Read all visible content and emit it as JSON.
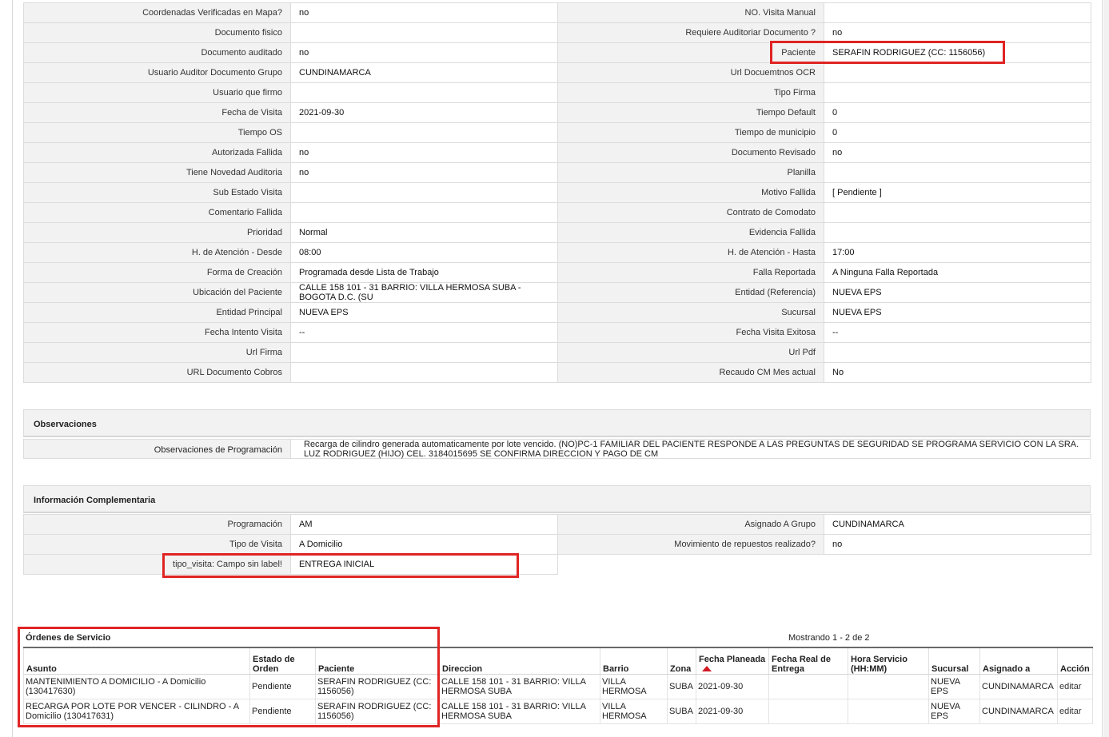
{
  "main_rows": [
    {
      "left_label": "Coordenadas Verificadas en Mapa?",
      "left_value": "no",
      "right_label": "NO. Visita Manual",
      "right_value": ""
    },
    {
      "left_label": "Documento fisico",
      "left_value": "",
      "right_label": "Requiere Auditoriar Documento ?",
      "right_value": "no"
    },
    {
      "left_label": "Documento auditado",
      "left_value": "no",
      "right_label": "Paciente",
      "right_value": "SERAFIN RODRIGUEZ (CC: 1156056)"
    },
    {
      "left_label": "Usuario Auditor Documento Grupo",
      "left_value": "CUNDINAMARCA",
      "right_label": "Url Docuemtnos OCR",
      "right_value": ""
    },
    {
      "left_label": "Usuario que firmo",
      "left_value": "",
      "right_label": "Tipo Firma",
      "right_value": ""
    },
    {
      "left_label": "Fecha de Visita",
      "left_value": "2021-09-30",
      "right_label": "Tiempo Default",
      "right_value": "0"
    },
    {
      "left_label": "Tiempo OS",
      "left_value": "",
      "right_label": "Tiempo de municipio",
      "right_value": "0"
    },
    {
      "left_label": "Autorizada Fallida",
      "left_value": "no",
      "right_label": "Documento Revisado",
      "right_value": "no"
    },
    {
      "left_label": "Tiene Novedad Auditoria",
      "left_value": "no",
      "right_label": "Planilla",
      "right_value": ""
    },
    {
      "left_label": "Sub Estado Visita",
      "left_value": "",
      "right_label": "Motivo Fallida",
      "right_value": "[ Pendiente ]"
    },
    {
      "left_label": "Comentario Fallida",
      "left_value": "",
      "right_label": "Contrato de Comodato",
      "right_value": ""
    },
    {
      "left_label": "Prioridad",
      "left_value": "Normal",
      "right_label": "Evidencia Fallida",
      "right_value": ""
    },
    {
      "left_label": "H. de Atención - Desde",
      "left_value": "08:00",
      "right_label": "H. de Atención - Hasta",
      "right_value": "17:00"
    },
    {
      "left_label": "Forma de Creación",
      "left_value": "Programada desde Lista de Trabajo",
      "right_label": "Falla Reportada",
      "right_value": "A Ninguna Falla Reportada"
    },
    {
      "left_label": "Ubicación del Paciente",
      "left_value": "CALLE 158 101 - 31 BARRIO: VILLA HERMOSA SUBA - BOGOTA D.C. (SU",
      "right_label": "Entidad (Referencia)",
      "right_value": "NUEVA EPS"
    },
    {
      "left_label": "Entidad Principal",
      "left_value": "NUEVA EPS",
      "right_label": "Sucursal",
      "right_value": "NUEVA EPS"
    },
    {
      "left_label": "Fecha Intento Visita",
      "left_value": "--",
      "right_label": "Fecha Visita Exitosa",
      "right_value": "--"
    },
    {
      "left_label": "Url Firma",
      "left_value": "",
      "right_label": "Url Pdf",
      "right_value": ""
    },
    {
      "left_label": "URL Documento Cobros",
      "left_value": "",
      "right_label": "Recaudo CM Mes actual",
      "right_value": "No"
    }
  ],
  "observaciones": {
    "title": "Observaciones",
    "label": "Observaciones de Programación",
    "value": "Recarga de cilindro generada automaticamente por lote vencido. (NO)PC-1 FAMILIAR DEL PACIENTE RESPONDE A LAS PREGUNTAS DE SEGURIDAD SE PROGRAMA SERVICIO CON LA SRA. LUZ RODRIGUEZ (HIJO) CEL. 3184015695 SE CONFIRMA DIRECCION Y PAGO DE CM"
  },
  "complementaria": {
    "title": "Información Complementaria",
    "rows": [
      {
        "left_label": "Programación",
        "left_value": "AM",
        "right_label": "Asignado A Grupo",
        "right_value": "CUNDINAMARCA"
      },
      {
        "left_label": "Tipo de Visita",
        "left_value": "A Domicilio",
        "right_label": "Movimiento de repuestos realizado?",
        "right_value": "no"
      }
    ],
    "extra": {
      "label": "tipo_visita: Campo sin label!",
      "value": "ENTREGA INICIAL"
    }
  },
  "orders": {
    "title": "Órdenes de Servicio",
    "paging": "Mostrando 1 - 2 de 2",
    "headers": {
      "asunto": "Asunto",
      "estado": "Estado de Orden",
      "paciente": "Paciente",
      "direccion": "Direccion",
      "barrio": "Barrio",
      "zona": "Zona",
      "fecha_planeada": "Fecha Planeada",
      "fecha_real": "Fecha Real de Entrega",
      "hora": "Hora Servicio (HH:MM)",
      "sucursal": "Sucursal",
      "asignado": "Asignado a",
      "accion": "Acción"
    },
    "rows": [
      {
        "asunto": "MANTENIMIENTO A DOMICILIO - A Domicilio (130417630)",
        "estado": "Pendiente",
        "paciente": "SERAFIN RODRIGUEZ (CC: 1156056)",
        "direccion": "CALLE 158 101 - 31 BARRIO: VILLA HERMOSA SUBA",
        "barrio": "VILLA HERMOSA",
        "zona": "SUBA",
        "fecha_planeada": "2021-09-30",
        "fecha_real": "",
        "hora": "",
        "sucursal": "NUEVA EPS",
        "asignado": "CUNDINAMARCA",
        "accion": "editar"
      },
      {
        "asunto": "RECARGA POR LOTE POR VENCER - CILINDRO - A Domicilio (130417631)",
        "estado": "Pendiente",
        "paciente": "SERAFIN RODRIGUEZ (CC: 1156056)",
        "direccion": "CALLE 158 101 - 31 BARRIO: VILLA HERMOSA SUBA",
        "barrio": "VILLA HERMOSA",
        "zona": "SUBA",
        "fecha_planeada": "2021-09-30",
        "fecha_real": "",
        "hora": "",
        "sucursal": "NUEVA EPS",
        "asignado": "CUNDINAMARCA",
        "accion": "editar"
      }
    ]
  },
  "colors": {
    "highlight": "#e02424",
    "sort_indicator": "#d11a24",
    "label_bg": "#f2f2f2"
  },
  "icons": {
    "sort": "sort-ascending-icon"
  }
}
